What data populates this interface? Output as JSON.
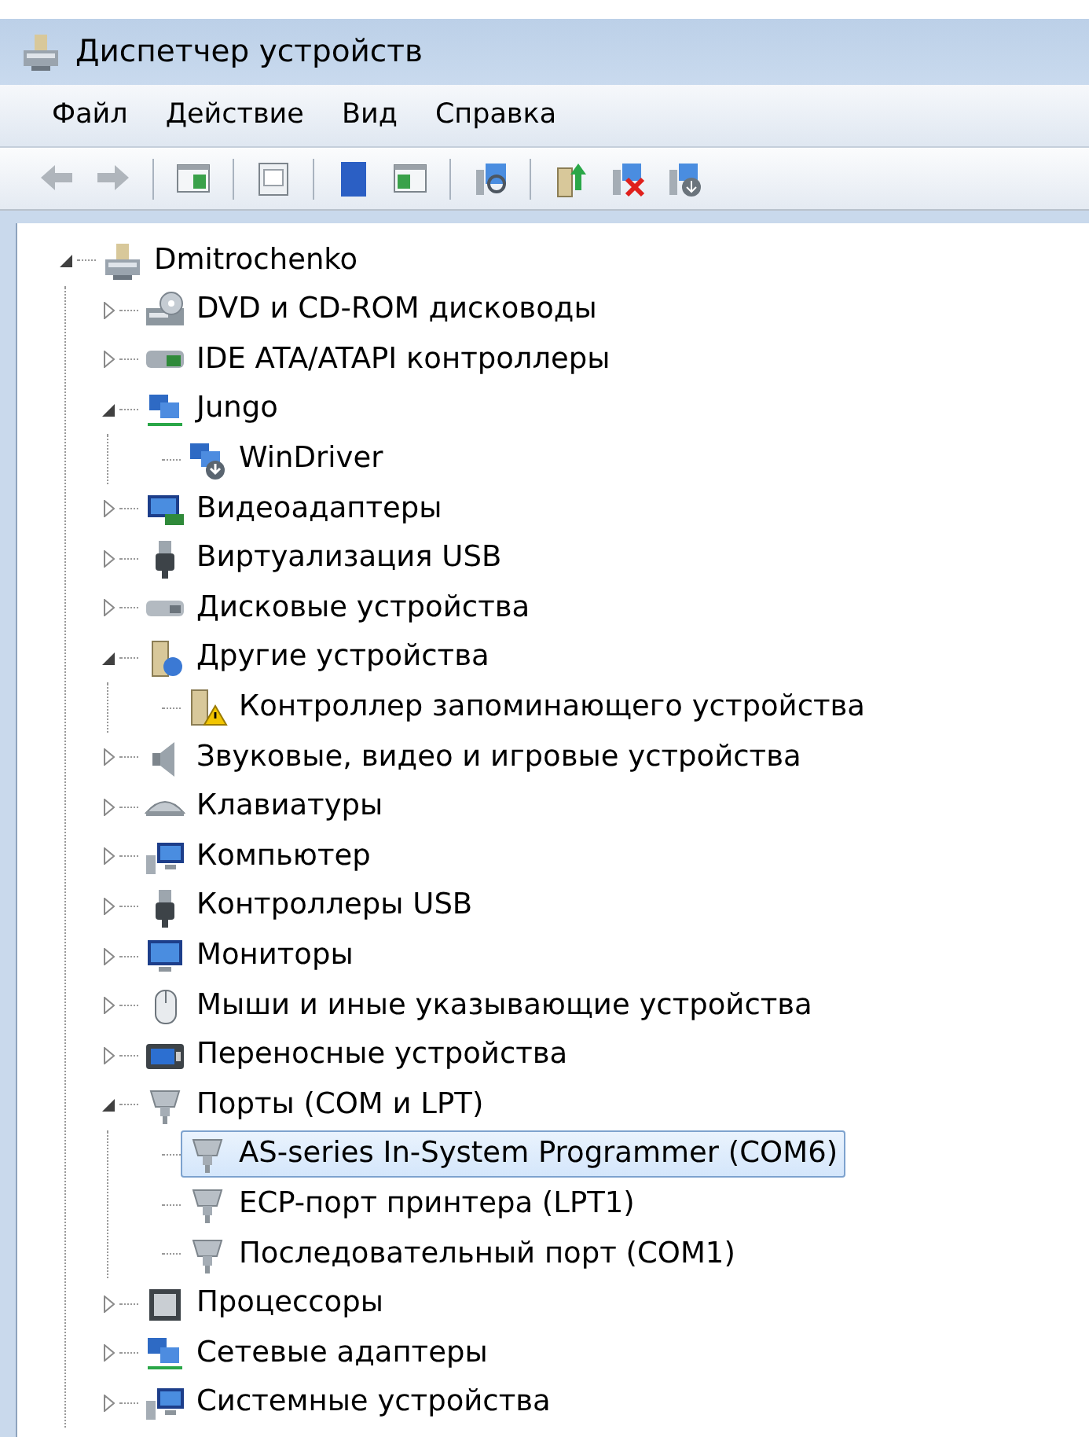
{
  "window": {
    "title": "Диспетчер устройств"
  },
  "menu": [
    {
      "label": "Файл"
    },
    {
      "label": "Действие"
    },
    {
      "label": "Вид"
    },
    {
      "label": "Справка"
    }
  ],
  "toolbar": [
    {
      "kind": "back",
      "disabled": true
    },
    {
      "kind": "forward",
      "disabled": true
    },
    {
      "kind": "separator"
    },
    {
      "kind": "console",
      "disabled": false
    },
    {
      "kind": "separator"
    },
    {
      "kind": "properties",
      "disabled": false
    },
    {
      "kind": "separator"
    },
    {
      "kind": "help",
      "disabled": false
    },
    {
      "kind": "pane",
      "disabled": false
    },
    {
      "kind": "separator"
    },
    {
      "kind": "scan",
      "disabled": false
    },
    {
      "kind": "separator"
    },
    {
      "kind": "update",
      "disabled": false
    },
    {
      "kind": "uninstall",
      "disabled": false
    },
    {
      "kind": "disable",
      "disabled": false
    }
  ],
  "tree": [
    {
      "label": "Dmitrochenko",
      "kind": "computer",
      "expanded": true,
      "selected": false,
      "children": [
        {
          "label": "DVD и CD-ROM дисководы",
          "kind": "disc",
          "expanded": false,
          "selected": false
        },
        {
          "label": "IDE ATA/ATAPI контроллеры",
          "kind": "ide",
          "expanded": false,
          "selected": false
        },
        {
          "label": "Jungo",
          "kind": "jungo",
          "expanded": true,
          "selected": false,
          "children": [
            {
              "label": "WinDriver",
              "kind": "driver",
              "selected": false
            }
          ]
        },
        {
          "label": "Видеоадаптеры",
          "kind": "display",
          "expanded": false,
          "selected": false
        },
        {
          "label": "Виртуализация USB",
          "kind": "usb",
          "expanded": false,
          "selected": false
        },
        {
          "label": "Дисковые устройства",
          "kind": "disk",
          "expanded": false,
          "selected": false
        },
        {
          "label": "Другие устройства",
          "kind": "other",
          "expanded": true,
          "selected": false,
          "children": [
            {
              "label": "Контроллер запоминающего устройства",
              "kind": "warning",
              "selected": false
            }
          ]
        },
        {
          "label": "Звуковые, видео и игровые устройства",
          "kind": "sound",
          "expanded": false,
          "selected": false
        },
        {
          "label": "Клавиатуры",
          "kind": "keyboard",
          "expanded": false,
          "selected": false
        },
        {
          "label": "Компьютер",
          "kind": "pc",
          "expanded": false,
          "selected": false
        },
        {
          "label": "Контроллеры USB",
          "kind": "usb",
          "expanded": false,
          "selected": false
        },
        {
          "label": "Мониторы",
          "kind": "monitor",
          "expanded": false,
          "selected": false
        },
        {
          "label": "Мыши и иные указывающие устройства",
          "kind": "mouse",
          "expanded": false,
          "selected": false
        },
        {
          "label": "Переносные устройства",
          "kind": "portable",
          "expanded": false,
          "selected": false
        },
        {
          "label": "Порты (COM и LPT)",
          "kind": "port",
          "expanded": true,
          "selected": false,
          "children": [
            {
              "label": "AS-series In-System Programmer (COM6)",
              "kind": "port",
              "selected": true
            },
            {
              "label": "ECP-порт принтера (LPT1)",
              "kind": "port",
              "selected": false
            },
            {
              "label": "Последовательный порт (COM1)",
              "kind": "port",
              "selected": false
            }
          ]
        },
        {
          "label": "Процессоры",
          "kind": "cpu",
          "expanded": false,
          "selected": false
        },
        {
          "label": "Сетевые адаптеры",
          "kind": "network",
          "expanded": false,
          "selected": false
        },
        {
          "label": "Системные устройства",
          "kind": "pc",
          "expanded": false,
          "selected": false
        }
      ]
    }
  ]
}
